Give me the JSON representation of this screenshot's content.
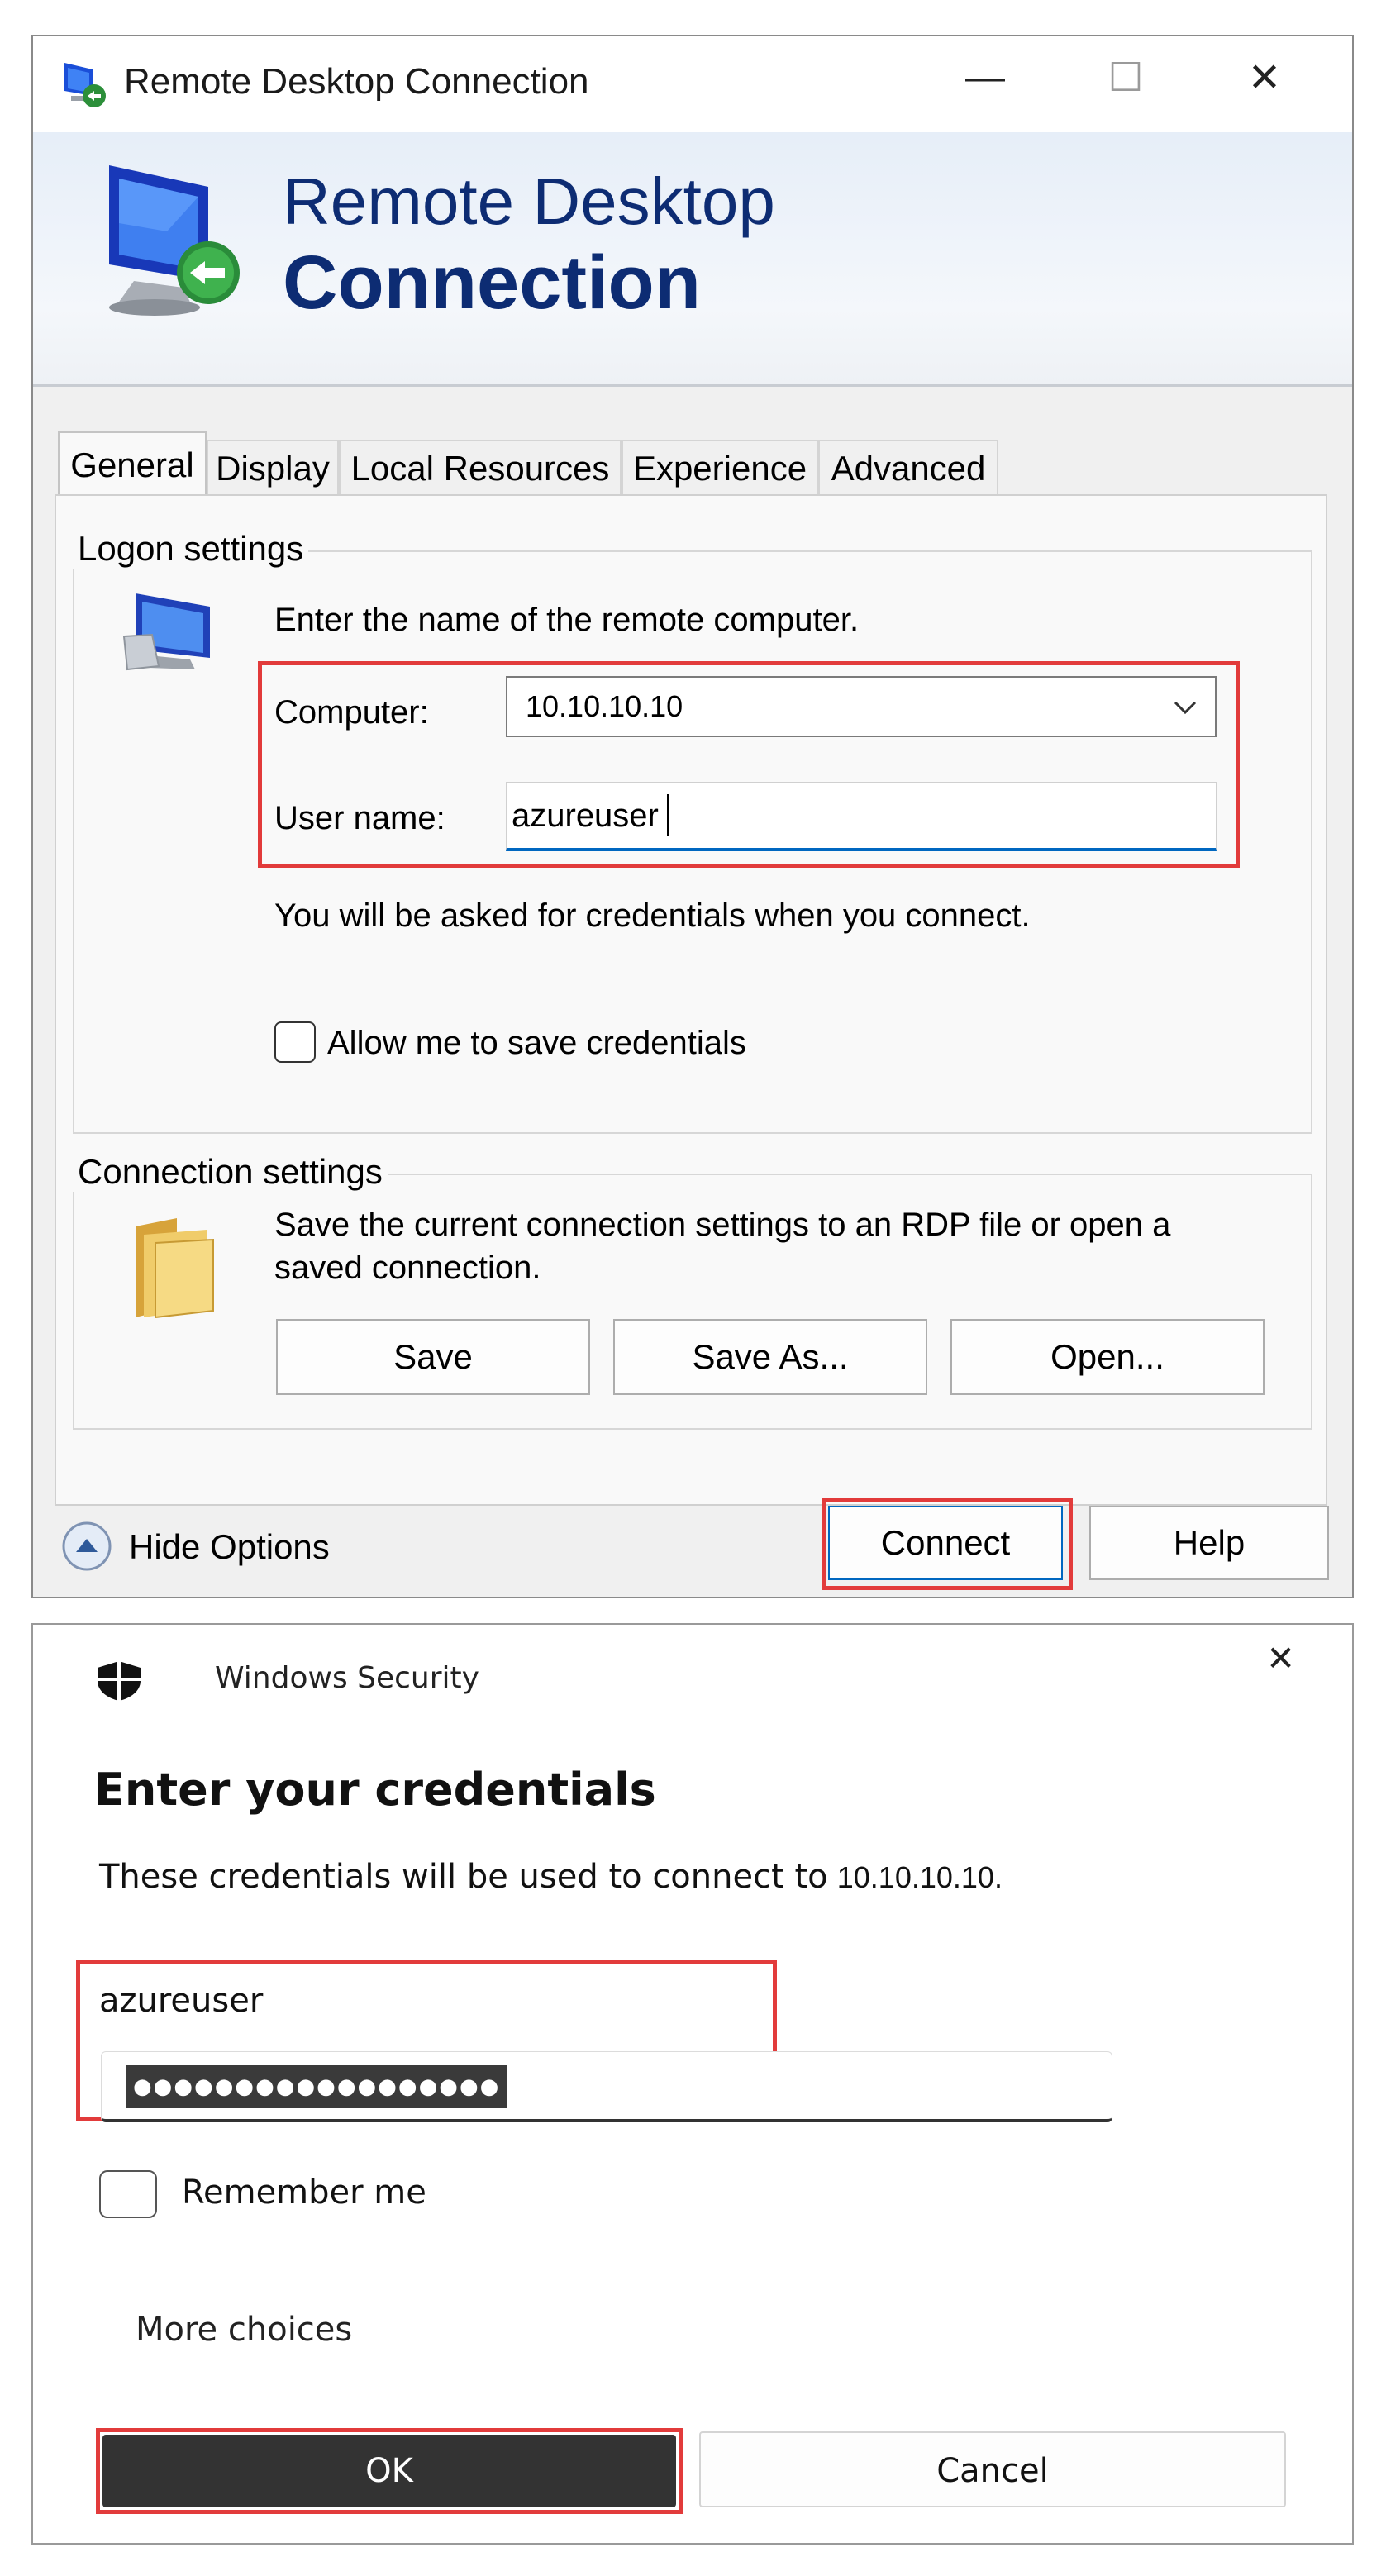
{
  "rdp": {
    "title": "Remote Desktop Connection",
    "window_controls": {
      "minimize": "—",
      "maximize": "☐",
      "close": "✕"
    },
    "banner": {
      "line1": "Remote Desktop",
      "line2": "Connection"
    },
    "tabs": [
      {
        "label": "General",
        "active": true
      },
      {
        "label": "Display",
        "active": false
      },
      {
        "label": "Local Resources",
        "active": false
      },
      {
        "label": "Experience",
        "active": false
      },
      {
        "label": "Advanced",
        "active": false
      }
    ],
    "logon": {
      "group_label": "Logon settings",
      "prompt": "Enter the name of the remote computer.",
      "computer_label": "Computer:",
      "computer_value": "10.10.10.10",
      "username_label": "User name:",
      "username_value": "azureuser",
      "credentials_note": "You will be asked for credentials when you connect.",
      "save_credentials_label": "Allow me to save credentials",
      "save_credentials_checked": false
    },
    "connection": {
      "group_label": "Connection settings",
      "description_line1": "Save the current connection settings to an RDP file or open a",
      "description_line2": "saved connection.",
      "save_button": "Save",
      "save_as_button": "Save As...",
      "open_button": "Open..."
    },
    "hide_options": "Hide Options",
    "connect_button": "Connect",
    "help_button": "Help"
  },
  "security": {
    "app_name": "Windows Security",
    "close": "✕",
    "heading": "Enter your credentials",
    "description": "These credentials will be used to connect to",
    "target": "10.10.10.10.",
    "username": "azureuser",
    "password_masked": "●●●●●●●●●●●●●●●●●●",
    "remember_me_label": "Remember me",
    "remember_me_checked": false,
    "more_choices": "More choices",
    "ok_button": "OK",
    "cancel_button": "Cancel"
  },
  "colors": {
    "highlight_red": "#e23b3b",
    "banner_text": "#0d2c73",
    "focus_blue": "#0067c0",
    "ok_button_bg": "#333333"
  }
}
